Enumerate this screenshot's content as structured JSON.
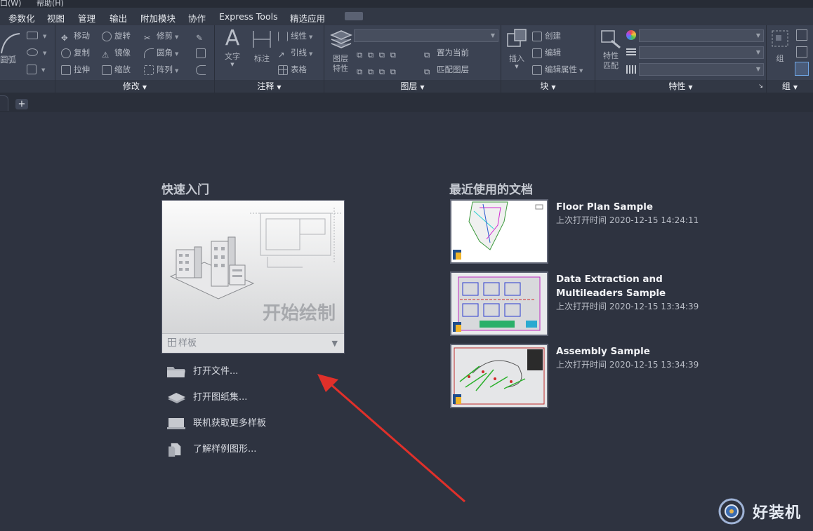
{
  "topbar": {
    "window_menu": "口(W)",
    "help_menu": "帮助(H)"
  },
  "menubar": {
    "items": [
      "参数化",
      "视图",
      "管理",
      "输出",
      "附加模块",
      "协作",
      "Express Tools",
      "精选应用"
    ]
  },
  "ribbon": {
    "draw_panel": {
      "arc_label": "圆弧"
    },
    "modify_panel": {
      "title": "修改",
      "tools": [
        "移动",
        "旋转",
        "修剪",
        "复制",
        "镜像",
        "圆角",
        "拉伸",
        "缩放",
        "阵列"
      ]
    },
    "annotate_panel": {
      "title": "注释",
      "text_label": "文字",
      "dim_label": "标注",
      "tools": [
        "线性",
        "引线",
        "表格"
      ]
    },
    "layers_panel": {
      "title": "图层",
      "layer_props_label": "图层\n特性",
      "tools": [
        "置为当前",
        "匹配图层"
      ]
    },
    "block_panel": {
      "title": "块",
      "insert_label": "插入",
      "tools": [
        "创建",
        "编辑",
        "编辑属性"
      ]
    },
    "properties_panel": {
      "title": "特性",
      "match_label": "特性\n匹配"
    },
    "group_panel": {
      "title": "组",
      "group_label": "组"
    }
  },
  "tabs": {
    "add_label": "+"
  },
  "start": {
    "quick_start_title": "快速入门",
    "card_label": "开始绘制",
    "template_label": "样板",
    "links": [
      "打开文件...",
      "打开图纸集...",
      "联机获取更多样板",
      "了解样例图形..."
    ]
  },
  "recent": {
    "title": "最近使用的文档",
    "items": [
      {
        "name": "Floor Plan Sample",
        "time": "上次打开时间 2020-12-15 14:24:11"
      },
      {
        "name": "Data Extraction and\nMultileaders Sample",
        "time": "上次打开时间 2020-12-15 13:34:39"
      },
      {
        "name": "Assembly Sample",
        "time": "上次打开时间 2020-12-15 13:34:39"
      }
    ]
  },
  "watermark": {
    "text": "好装机"
  },
  "colors": {
    "accent_arrow": "#e0302a",
    "background": "#2e3340",
    "ribbon": "#3b4252"
  }
}
